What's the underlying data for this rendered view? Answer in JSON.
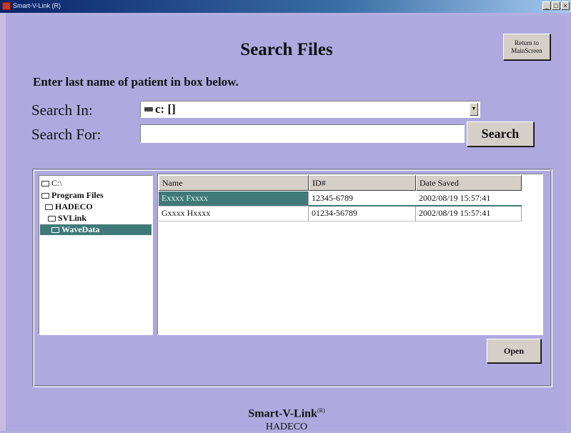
{
  "window": {
    "title": "Smart-V-Link (R)",
    "controls": [
      "_",
      "□",
      "×"
    ]
  },
  "header": {
    "title": "Search Files",
    "return_button": "Return to MainScreen"
  },
  "instruction": "Enter last name of patient in box below.",
  "search_in": {
    "label": "Search In:",
    "value": "c: []"
  },
  "search_for": {
    "label": "Search For:",
    "value": ""
  },
  "search_button": "Search",
  "tree": {
    "items": [
      {
        "label": "C:\\"
      },
      {
        "label": "Program Files"
      },
      {
        "label": "HADECO"
      },
      {
        "label": "SVLink"
      },
      {
        "label": "WaveData"
      }
    ]
  },
  "files": {
    "columns": [
      "Name",
      "ID#",
      "Date Saved"
    ],
    "rows": [
      {
        "name": "Exxxx Fxxxx",
        "id": "12345-6789",
        "date": "2002/08/19 15:57:41"
      },
      {
        "name": "Gxxxx Hxxxx",
        "id": "01234-56789",
        "date": "2002/08/19 15:57:41"
      }
    ]
  },
  "open_button": "Open",
  "footer": {
    "brand": "Smart-V-Link",
    "brand_mark": "(R)",
    "company": "HADECO"
  },
  "colors": {
    "background": "#b0a9df",
    "selection": "#3f7a79",
    "title_bar": "#0a246a"
  }
}
